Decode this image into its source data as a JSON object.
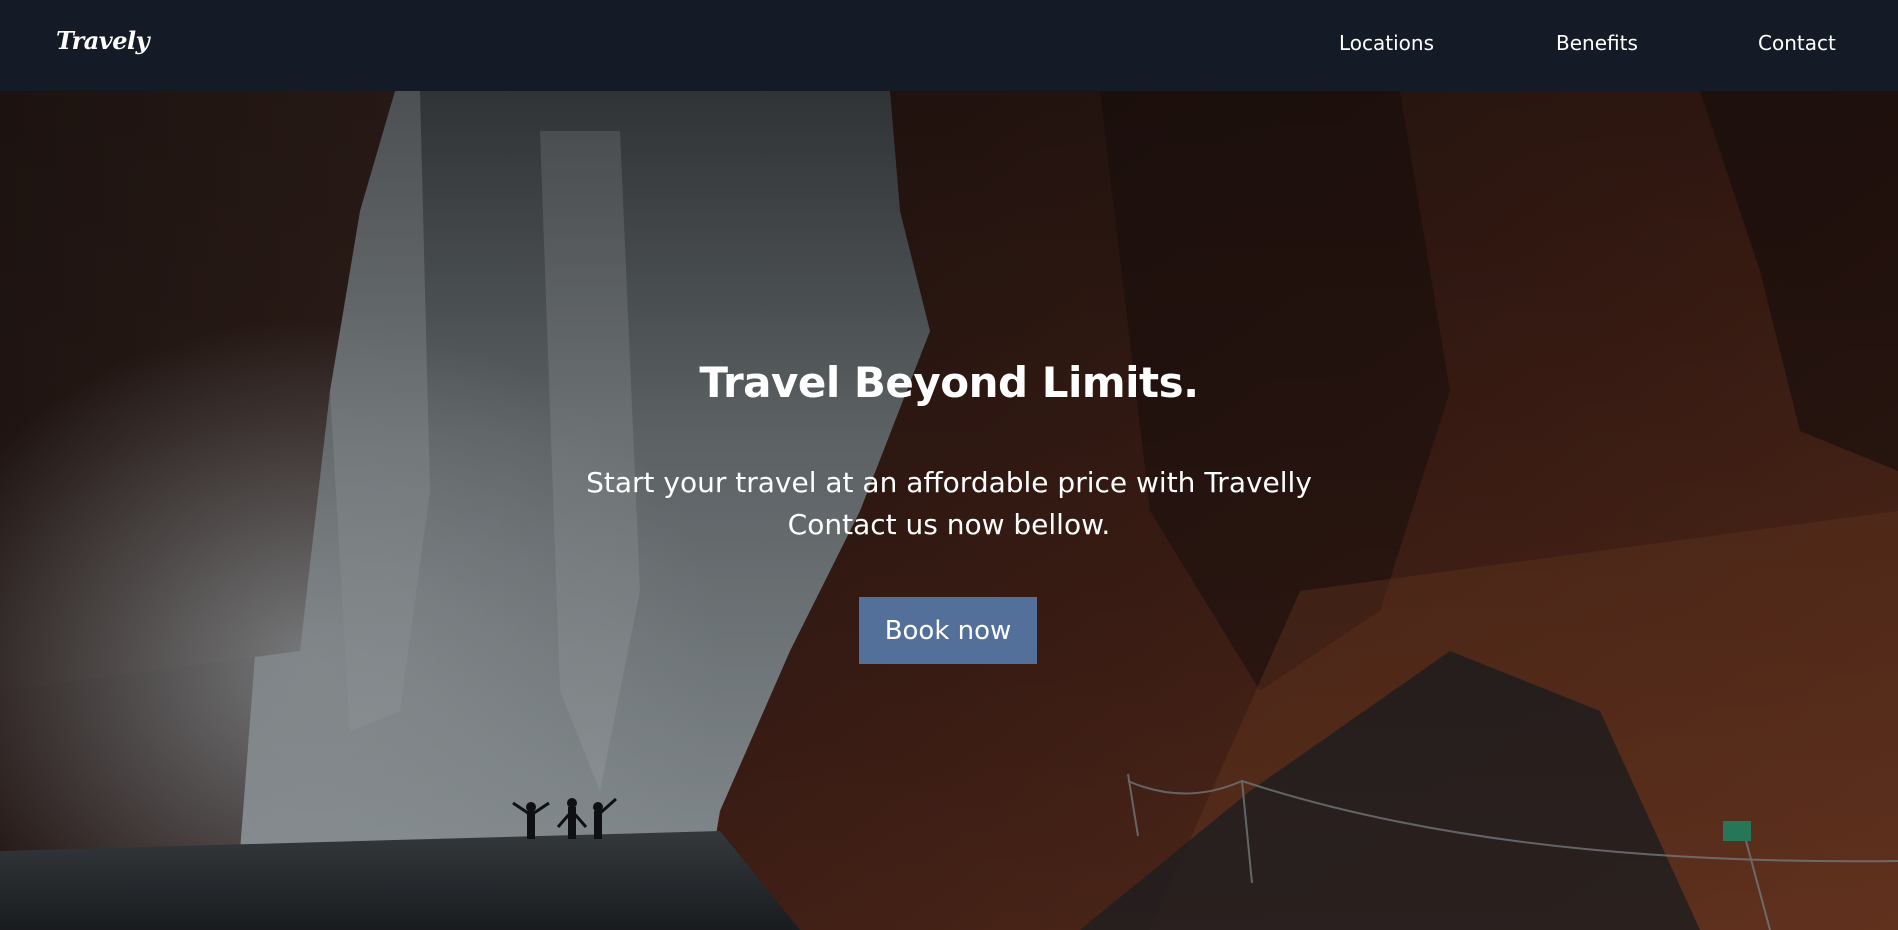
{
  "nav": {
    "brand": "Travely",
    "links": [
      {
        "label": "Locations"
      },
      {
        "label": "Benefits"
      },
      {
        "label": "Contact"
      }
    ]
  },
  "hero": {
    "title": "Travel Beyond Limits.",
    "subtitle_line1": "Start your travel at an affordable price with Travelly",
    "subtitle_line2": "Contact us now bellow.",
    "cta_label": "Book now",
    "background_image": "waterfall-cliff-photo"
  },
  "colors": {
    "navbar": "#141b26",
    "cta": "#52709a",
    "text": "#ffffff"
  }
}
